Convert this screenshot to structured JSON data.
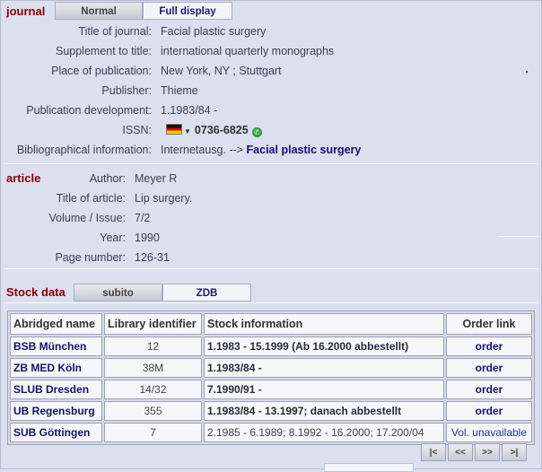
{
  "journal_section": {
    "label": "journal",
    "tabs": [
      "Normal",
      "Full display"
    ],
    "fields": [
      {
        "label": "Title of journal:",
        "value": "Facial plastic surgery"
      },
      {
        "label": "Supplement to title:",
        "value": "international quarterly monographs"
      },
      {
        "label": "Place of publication:",
        "value": "New York, NY ; Stuttgart"
      },
      {
        "label": "Publisher:",
        "value": "Thieme"
      },
      {
        "label": "Publication development:",
        "value": "1.1983/84 -"
      },
      {
        "label": "ISSN:",
        "value": "0736-6825"
      },
      {
        "label": "Bibliographical information:",
        "value": "Internetausg. --> ",
        "link": "Facial plastic surgery"
      }
    ]
  },
  "article_section": {
    "label": "article",
    "fields": [
      {
        "label": "Author:",
        "value": "Meyer R"
      },
      {
        "label": "Title of article:",
        "value": "Lip surgery."
      },
      {
        "label": "Volume / Issue:",
        "value": "7/2"
      },
      {
        "label": "Year:",
        "value": "1990"
      },
      {
        "label": "Page number:",
        "value": "126-31"
      }
    ]
  },
  "stock_section": {
    "label": "Stock data",
    "tabs": [
      "subito",
      "ZDB"
    ],
    "columns": [
      "Abridged name",
      "Library identifier",
      "Stock information",
      "Order link"
    ],
    "rows": [
      {
        "name": "BSB München",
        "id": "12",
        "stock": "1.1983 - 15.1999 (Ab 16.2000 abbestellt)",
        "order": "order",
        "bold_stock": true
      },
      {
        "name": "ZB MED Köln",
        "id": "38M",
        "stock": "1.1983/84 -",
        "order": "order",
        "bold_stock": true
      },
      {
        "name": "SLUB Dresden",
        "id": "14/32",
        "stock": "7.1990/91 -",
        "order": "order",
        "bold_stock": true
      },
      {
        "name": "UB Regensburg",
        "id": "355",
        "stock": "1.1983/84 - 13.1997; danach abbestellt",
        "order": "order",
        "bold_stock": true
      },
      {
        "name": "SUB Göttingen",
        "id": "7",
        "stock": "2.1985 - 6.1989; 8.1992 - 16.2000; 17.200/04",
        "order": "Vol. unavailable",
        "bold_stock": false
      }
    ]
  },
  "pager": [
    "|<",
    "<<",
    ">>",
    ">|"
  ],
  "icons": {
    "flag": "german-flag-icon",
    "phone": "phone-icon"
  }
}
